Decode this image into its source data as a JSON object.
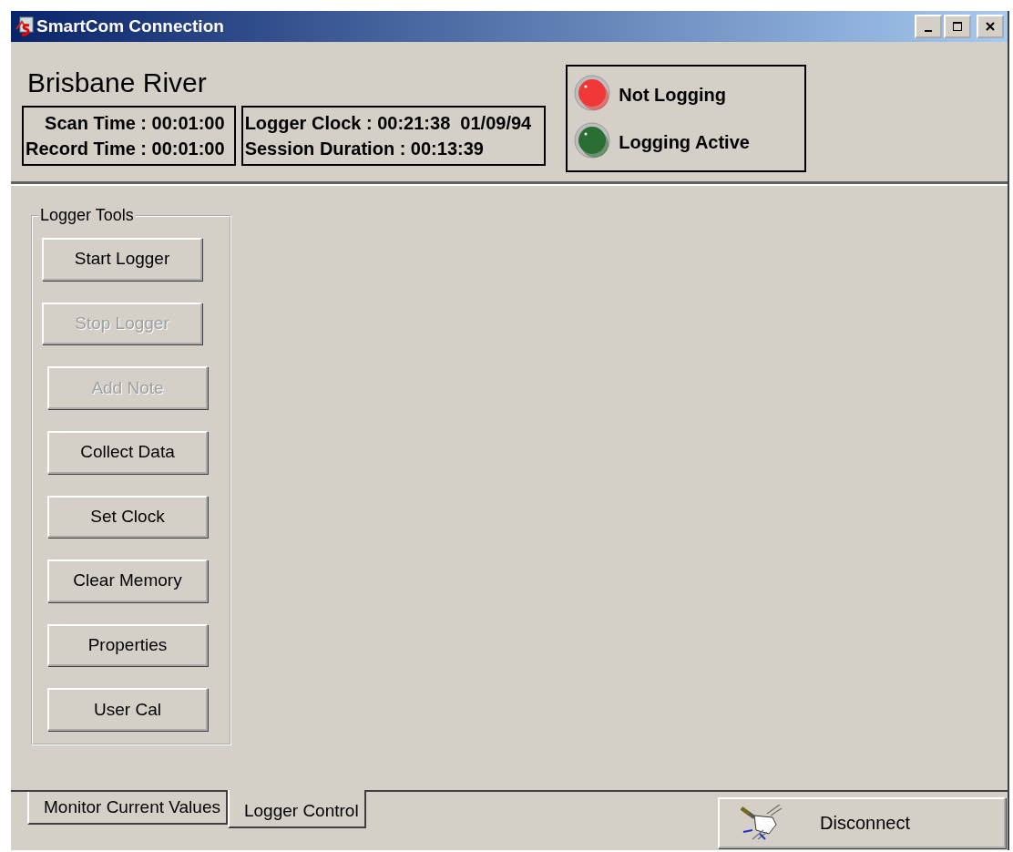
{
  "window": {
    "title": "SmartCom Connection"
  },
  "site_name": "Brisbane River",
  "times": [
    {
      "label": "Scan Time : 00:01:00"
    },
    {
      "label": "Record Time : 00:01:00"
    }
  ],
  "clock": [
    {
      "label": "Logger Clock : 00:21:38  01/09/94"
    },
    {
      "label": "Session Duration : 00:13:39"
    }
  ],
  "indicators": [
    {
      "label": "Not Logging",
      "color": "#f03838"
    },
    {
      "label": "Logging Active",
      "color": "#2a6e34"
    }
  ],
  "logger_tools": {
    "title": "Logger Tools",
    "buttons": [
      {
        "label": "Start Logger",
        "disabled": false
      },
      {
        "label": "Stop Logger",
        "disabled": true
      },
      {
        "label": "Add Note",
        "disabled": true
      },
      {
        "label": "Collect Data",
        "disabled": false
      },
      {
        "label": "Set Clock",
        "disabled": false
      },
      {
        "label": "Clear Memory",
        "disabled": false
      },
      {
        "label": "Properties",
        "disabled": false
      },
      {
        "label": "User Cal",
        "disabled": false
      }
    ]
  },
  "tabs": [
    {
      "label": "Monitor Current Values",
      "selected": false
    },
    {
      "label": "Logger Control",
      "selected": true
    }
  ],
  "disconnect_button": {
    "label": "Disconnect"
  }
}
